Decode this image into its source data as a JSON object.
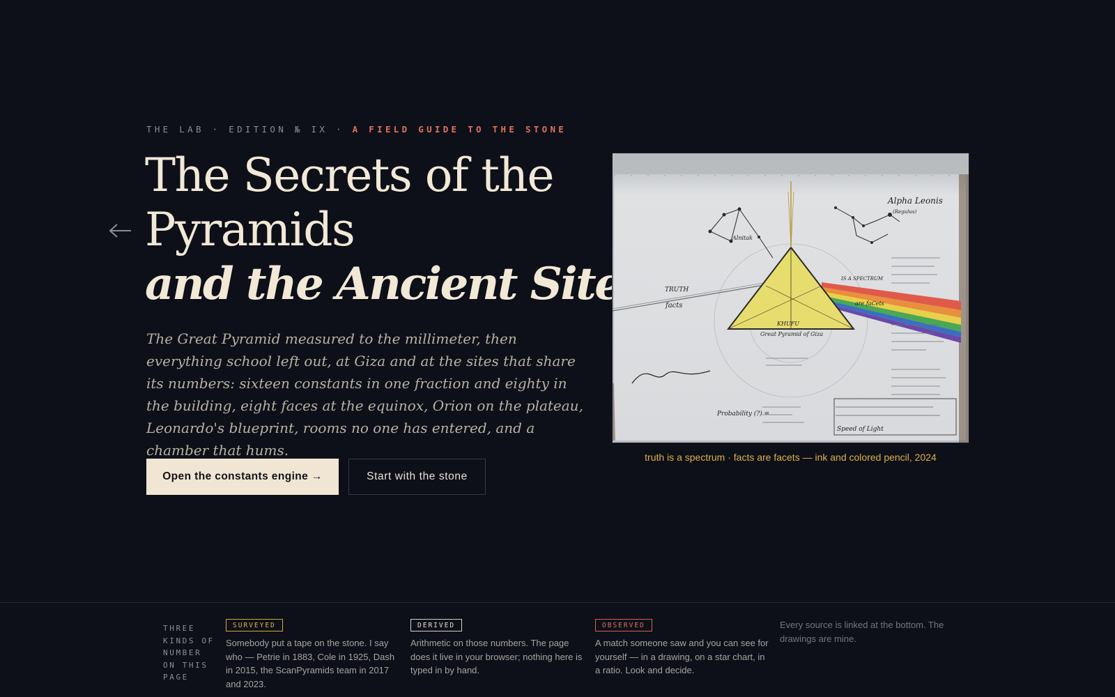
{
  "hero": {
    "kicker_main": "THE LAB · EDITION № IX · ",
    "kicker_accent": "A FIELD GUIDE TO THE STONE",
    "title_line1": "The Secrets of the",
    "title_line2": "Pyramids",
    "title_line3": "and the Ancient Sites",
    "lede": "The Great Pyramid measured to the millimeter, then everything school left out, at Giza and at the sites that share its numbers: sixteen constants in one fraction and eighty in the building, eight faces at the equinox, Orion on the plateau, Leonardo's blueprint, rooms no one has entered, and a chamber that hums.",
    "primary_button": "Open the constants engine →",
    "secondary_button": "Start with the stone",
    "back_icon": "arrow-left-icon"
  },
  "figure": {
    "caption": "truth is a spectrum · facts are facets — ink and colored pencil, 2024",
    "drawing": {
      "alpha_leonis": "Alpha Leonis",
      "alpha_leonis_note": "(Regulus)",
      "alnitak": "Alnitak",
      "truth": "TRUTH",
      "facts": "facts",
      "spectrum": "IS A SPECTRUM",
      "facets": "are faCets",
      "khufu": "KHUFU",
      "great_pyramid": "Great Pyramid of Giza",
      "probability": "Probability (?) =",
      "speed_of_light": "Speed of Light"
    }
  },
  "kinds": {
    "label": "THREE KINDS OF NUMBER ON THIS PAGE",
    "items": [
      {
        "badge": "SURVEYED",
        "text": "Somebody put a tape on the stone. I say who — Petrie in 1883, Cole in 1925, Dash in 2015, the ScanPyramids team in 2017 and 2023."
      },
      {
        "badge": "DERIVED",
        "text": "Arithmetic on those numbers. The page does it live in your browser; nothing here is typed in by hand."
      },
      {
        "badge": "OBSERVED",
        "text": "A match someone saw and you can see for yourself — in a drawing, on a star chart, in a ratio. Look and decide."
      }
    ],
    "note": "Every source is linked at the bottom. The drawings are mine."
  },
  "colors": {
    "background": "#0d1019",
    "cream": "#f1e8d6",
    "accent_red": "#e0715c",
    "accent_gold": "#e0b049"
  }
}
